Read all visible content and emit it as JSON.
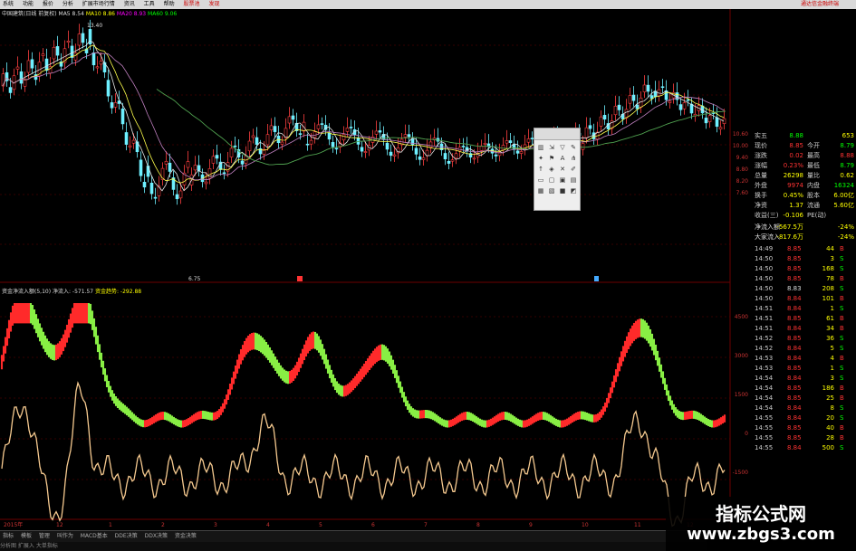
{
  "menu": {
    "items": [
      "系统",
      "功能",
      "报价",
      "分析",
      "扩展市场行情",
      "资讯",
      "工具",
      "帮助"
    ],
    "red_item": "股票池",
    "red_item2": "发现",
    "right_label": "通达信金融终端"
  },
  "top_info": {
    "title": "中国建筑(日线 前复权)",
    "ma5": "MA5 8.54",
    "ma10": "MA10 8.86",
    "ma20": "MA20 8.93",
    "ma60": "MA60 9.06",
    "high_label": "13.40",
    "low_label": "6.75"
  },
  "low_info": {
    "name": "资金净流入额(5,10)",
    "v1": "净流入: -571.57",
    "v2": "资金趋势: -292.88"
  },
  "price_axis": [
    "10.60",
    "10.00",
    "9.40",
    "8.80",
    "8.20",
    "7.60"
  ],
  "ind_axis": [
    "4500",
    "3000",
    "1500",
    "0",
    "-1500"
  ],
  "date_axis": [
    "2015年",
    "12",
    "1",
    "2",
    "3",
    "4",
    "5",
    "6",
    "7",
    "8",
    "9",
    "10",
    "11",
    "12"
  ],
  "toolbox": {
    "icons": [
      "bars-icon",
      "arrow-down-icon",
      "triangle-icon",
      "pen-icon",
      "pin-icon",
      "flag-icon",
      "text-icon",
      "fork-icon",
      "up-arrow-icon",
      "shapes-icon",
      "x-icon",
      "pencil-icon",
      "window-icon",
      "rect-icon",
      "box-icon",
      "panel-icon",
      "grid-icon",
      "grid2-icon",
      "square-icon",
      "layout-icon"
    ],
    "glyphs": [
      "▥",
      "⇲",
      "▽",
      "✎",
      "✦",
      "⚑",
      "A",
      "⋔",
      "↑",
      "◈",
      "✕",
      "✐",
      "▭",
      "▢",
      "▣",
      "▤",
      "▦",
      "▧",
      "■",
      "◩"
    ]
  },
  "quote": {
    "top_cut": "五",
    "rows": [
      {
        "l": "实五",
        "v": "8.88",
        "l2": "",
        "v2": "653",
        "vc": "#0f0",
        "v2c": "#ff0"
      },
      {
        "l": "现价",
        "v": "8.85",
        "l2": "今开",
        "v2": "8.79",
        "vc": "#f33",
        "v2c": "#0f0"
      },
      {
        "l": "涨跌",
        "v": "0.02",
        "l2": "最高",
        "v2": "8.88",
        "vc": "#f33",
        "v2c": "#f33"
      },
      {
        "l": "涨幅",
        "v": "0.23%",
        "l2": "最低",
        "v2": "8.79",
        "vc": "#f33",
        "v2c": "#0f0"
      },
      {
        "l": "总量",
        "v": "26298",
        "l2": "量比",
        "v2": "0.62",
        "vc": "#ff0",
        "v2c": "#ff0"
      },
      {
        "l": "外盘",
        "v": "9974",
        "l2": "内盘",
        "v2": "16324",
        "vc": "#f33",
        "v2c": "#0f0"
      },
      {
        "l": "换手",
        "v": "0.45%",
        "l2": "股本",
        "v2": "6.00亿",
        "vc": "#ff0",
        "v2c": "#ff0"
      },
      {
        "l": "净资",
        "v": "1.37",
        "l2": "流通",
        "v2": "5.60亿",
        "vc": "#ff0",
        "v2c": "#ff0"
      },
      {
        "l": "收益(三)",
        "v": "-0.106",
        "l2": "PE(动)",
        "v2": "",
        "vc": "#ff0",
        "v2c": "#ff0"
      }
    ],
    "flow1_label": "净流入额",
    "flow1_value": "-567.5万",
    "flow1_pct": "-24%",
    "flow2_label": "大家流入",
    "flow2_value": "-817.6万",
    "flow2_pct": "-24%",
    "ticks": [
      {
        "t": "14:49",
        "p": "8.85",
        "v": "44",
        "d": "B",
        "pc": "#f33",
        "dc": "#f33"
      },
      {
        "t": "14:50",
        "p": "8.85",
        "v": "3",
        "d": "S",
        "pc": "#f33",
        "dc": "#0f0"
      },
      {
        "t": "14:50",
        "p": "8.85",
        "v": "168",
        "d": "S",
        "pc": "#f33",
        "dc": "#0f0"
      },
      {
        "t": "14:50",
        "p": "8.85",
        "v": "78",
        "d": "B",
        "pc": "#f33",
        "dc": "#f33"
      },
      {
        "t": "14:50",
        "p": "8.83",
        "v": "208",
        "d": "S",
        "pc": "#ddd",
        "dc": "#0f0"
      },
      {
        "t": "14:50",
        "p": "8.84",
        "v": "101",
        "d": "B",
        "pc": "#f33",
        "dc": "#f33"
      },
      {
        "t": "14:51",
        "p": "8.84",
        "v": "1",
        "d": "S",
        "pc": "#f33",
        "dc": "#0f0"
      },
      {
        "t": "14:51",
        "p": "8.85",
        "v": "61",
        "d": "B",
        "pc": "#f33",
        "dc": "#f33"
      },
      {
        "t": "14:51",
        "p": "8.84",
        "v": "34",
        "d": "B",
        "pc": "#f33",
        "dc": "#f33"
      },
      {
        "t": "14:52",
        "p": "8.85",
        "v": "36",
        "d": "S",
        "pc": "#f33",
        "dc": "#0f0"
      },
      {
        "t": "14:52",
        "p": "8.84",
        "v": "5",
        "d": "S",
        "pc": "#f33",
        "dc": "#0f0"
      },
      {
        "t": "14:53",
        "p": "8.84",
        "v": "4",
        "d": "B",
        "pc": "#f33",
        "dc": "#f33"
      },
      {
        "t": "14:53",
        "p": "8.85",
        "v": "1",
        "d": "S",
        "pc": "#f33",
        "dc": "#0f0"
      },
      {
        "t": "14:54",
        "p": "8.84",
        "v": "3",
        "d": "S",
        "pc": "#f33",
        "dc": "#0f0"
      },
      {
        "t": "14:54",
        "p": "8.85",
        "v": "186",
        "d": "B",
        "pc": "#f33",
        "dc": "#f33"
      },
      {
        "t": "14:54",
        "p": "8.85",
        "v": "25",
        "d": "B",
        "pc": "#f33",
        "dc": "#f33"
      },
      {
        "t": "14:54",
        "p": "8.84",
        "v": "8",
        "d": "S",
        "pc": "#f33",
        "dc": "#0f0"
      },
      {
        "t": "14:55",
        "p": "8.84",
        "v": "20",
        "d": "S",
        "pc": "#f33",
        "dc": "#0f0"
      },
      {
        "t": "14:55",
        "p": "8.85",
        "v": "40",
        "d": "B",
        "pc": "#f33",
        "dc": "#f33"
      },
      {
        "t": "14:55",
        "p": "8.85",
        "v": "28",
        "d": "B",
        "pc": "#f33",
        "dc": "#f33"
      },
      {
        "t": "14:55",
        "p": "8.84",
        "v": "500",
        "d": "S",
        "pc": "#f33",
        "dc": "#0f0"
      }
    ]
  },
  "bottom_tabs": [
    "指标",
    "模板",
    "管理",
    "叫作为",
    "MACD基本",
    "DDE决策",
    "DDX决策",
    "资金决策"
  ],
  "status_text": "分析图 扩展入 大单指标",
  "watermark": {
    "line1": "指标公式网",
    "line2": "www.zbgs3.com"
  },
  "colors": {
    "up": "#ff2a2a",
    "down": "#88ee44",
    "orange": "#f5c98f",
    "ma_white": "#e6e6e6",
    "ma_yellow": "#ffff4d",
    "ma_magenta": "#c080c0",
    "ma_green": "#4fa04f",
    "grid": "#6b0000"
  }
}
